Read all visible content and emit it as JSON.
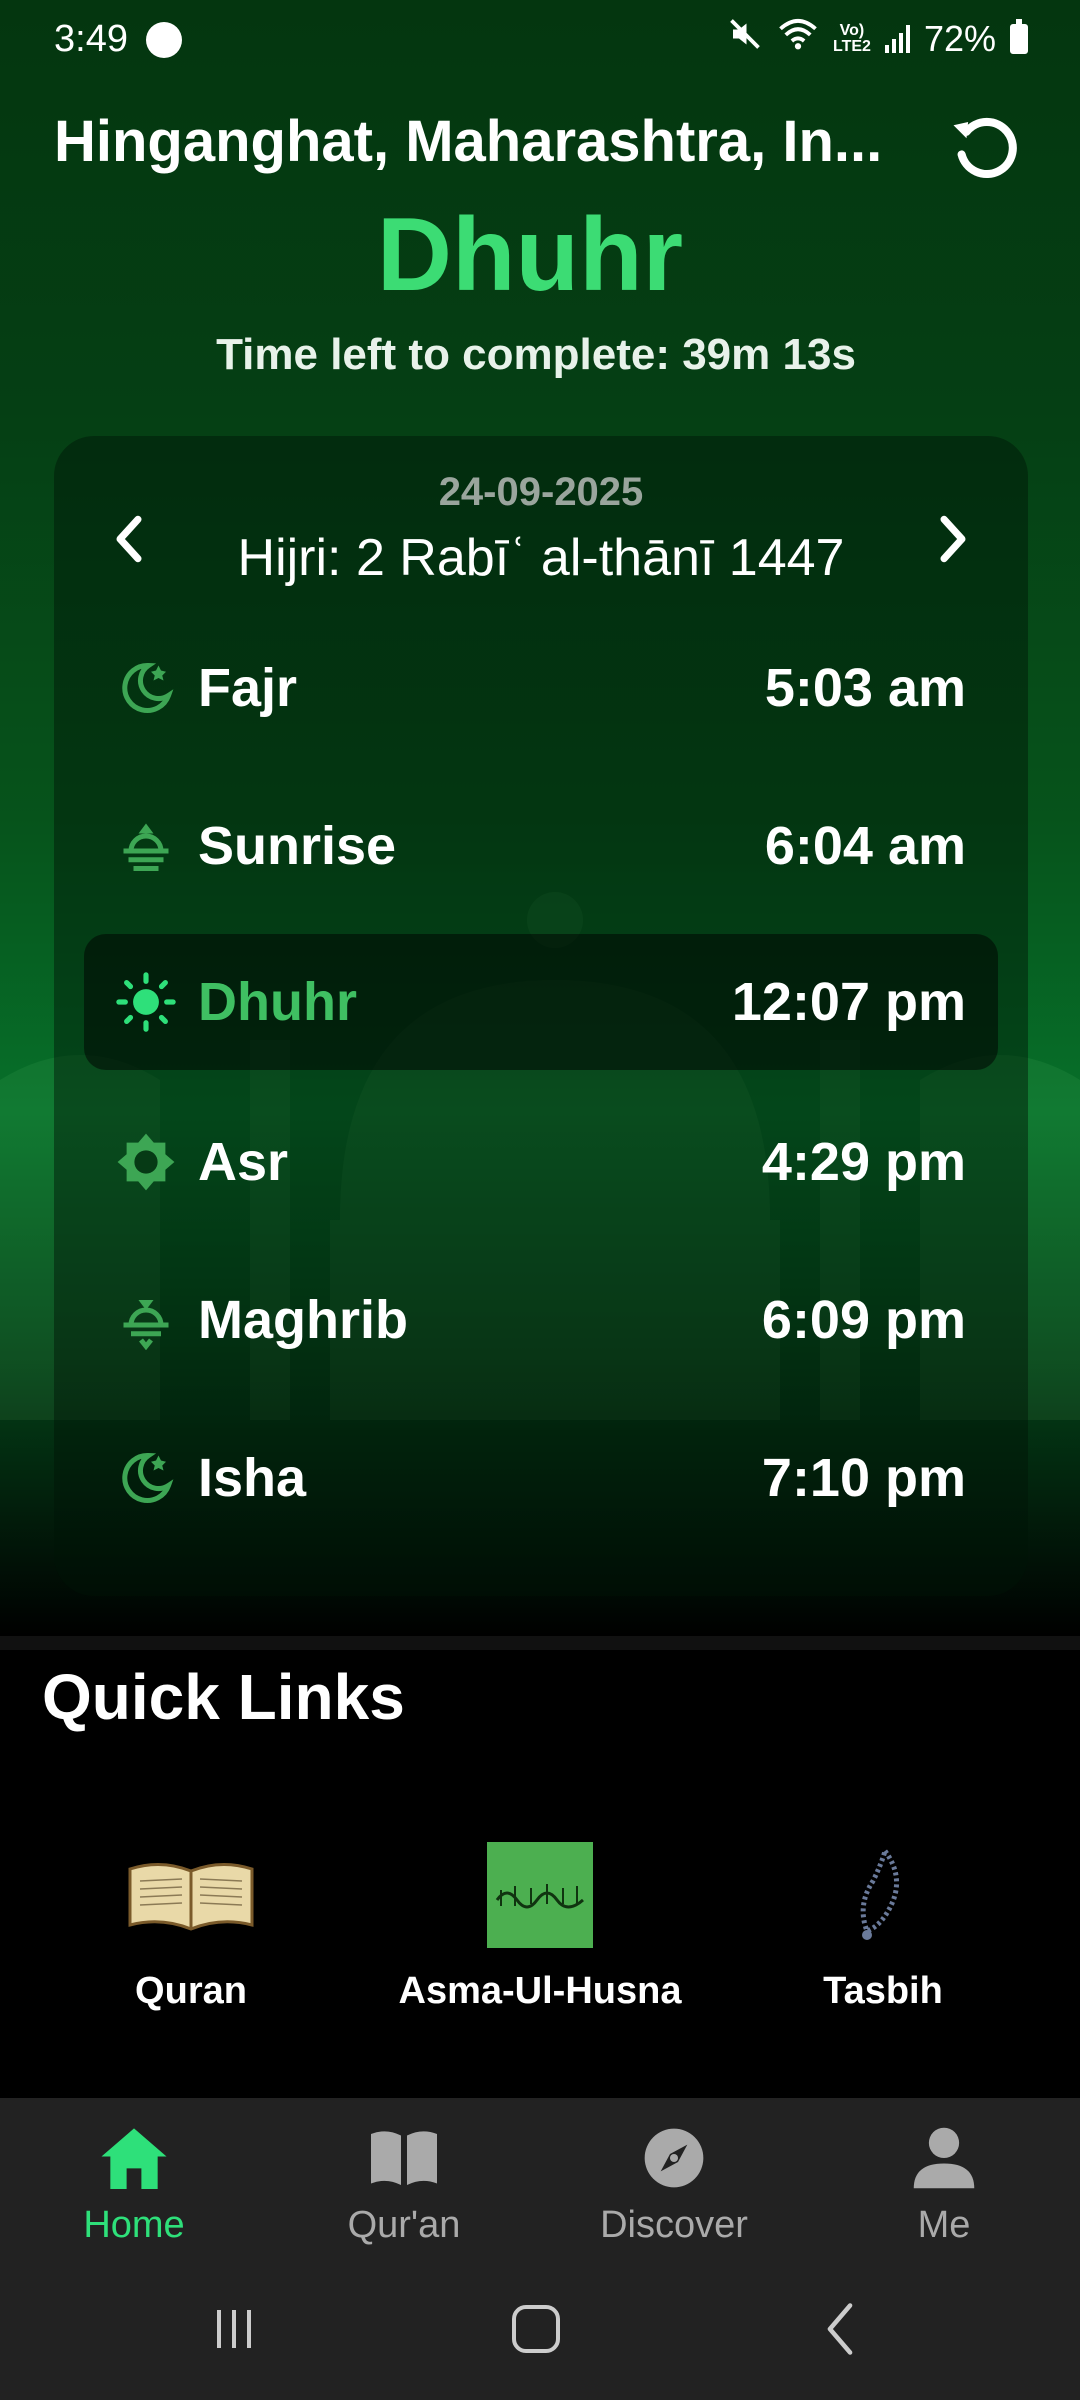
{
  "status_bar": {
    "time": "3:49",
    "battery": "72%"
  },
  "header": {
    "location": "Hinganghat, Maharashtra, In...",
    "current_prayer": "Dhuhr",
    "time_left": "Time left to complete: 39m 13s"
  },
  "card": {
    "date": "24-09-2025",
    "hijri": "Hijri: 2 Rabīʿ al-thānī 1447",
    "prayers": [
      {
        "name": "Fajr",
        "time": "5:03 am",
        "icon": "moon-star-icon",
        "active": false
      },
      {
        "name": "Sunrise",
        "time": "6:04 am",
        "icon": "sunrise-icon",
        "active": false
      },
      {
        "name": "Dhuhr",
        "time": "12:07 pm",
        "icon": "sun-icon",
        "active": true
      },
      {
        "name": "Asr",
        "time": "4:29 pm",
        "icon": "sun-outline-icon",
        "active": false
      },
      {
        "name": "Maghrib",
        "time": "6:09 pm",
        "icon": "sunset-icon",
        "active": false
      },
      {
        "name": "Isha",
        "time": "7:10 pm",
        "icon": "moon-star-icon",
        "active": false
      }
    ]
  },
  "quick_links": {
    "title": "Quick Links",
    "items": [
      {
        "label": "Quran",
        "icon": "quran-book-icon"
      },
      {
        "label": "Asma-Ul-Husna",
        "icon": "calligraphy-icon"
      },
      {
        "label": "Tasbih",
        "icon": "tasbih-beads-icon"
      }
    ]
  },
  "bottom_nav": {
    "items": [
      {
        "label": "Home",
        "icon": "home-icon",
        "active": true
      },
      {
        "label": "Qur'an",
        "icon": "book-icon",
        "active": false
      },
      {
        "label": "Discover",
        "icon": "compass-icon",
        "active": false
      },
      {
        "label": "Me",
        "icon": "person-icon",
        "active": false
      }
    ]
  },
  "colors": {
    "accent": "#3cdc74",
    "active_row_text": "#3fbf62",
    "icon_green": "#3da654",
    "nav_active": "#2ee07a"
  }
}
